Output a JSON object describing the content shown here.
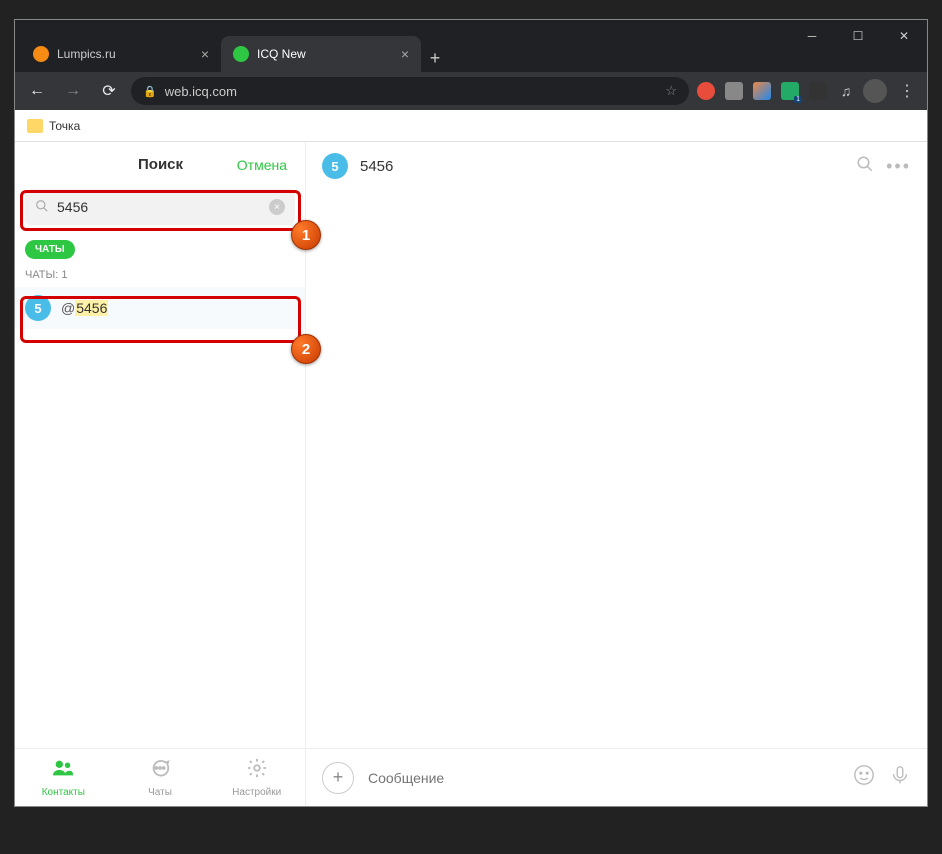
{
  "browser": {
    "tabs": [
      {
        "title": "Lumpics.ru",
        "favicon_color": "#f58b12",
        "active": false
      },
      {
        "title": "ICQ New",
        "favicon_color": "#2ec743",
        "active": true
      }
    ],
    "url": "web.icq.com",
    "bookmark_label": "Точка"
  },
  "sidebar": {
    "search_title": "Поиск",
    "cancel_label": "Отмена",
    "search_value": "5456",
    "chats_pill": "ЧАТЫ",
    "chats_count_label": "ЧАТЫ: 1",
    "result": {
      "avatar_letter": "5",
      "at": "@",
      "highlight": "5456"
    },
    "nav": {
      "contacts": "Контакты",
      "chats": "Чаты",
      "settings": "Настройки"
    }
  },
  "chat": {
    "header_avatar": "5",
    "header_name": "5456",
    "composer_placeholder": "Сообщение"
  },
  "annotations": {
    "m1": "1",
    "m2": "2"
  }
}
